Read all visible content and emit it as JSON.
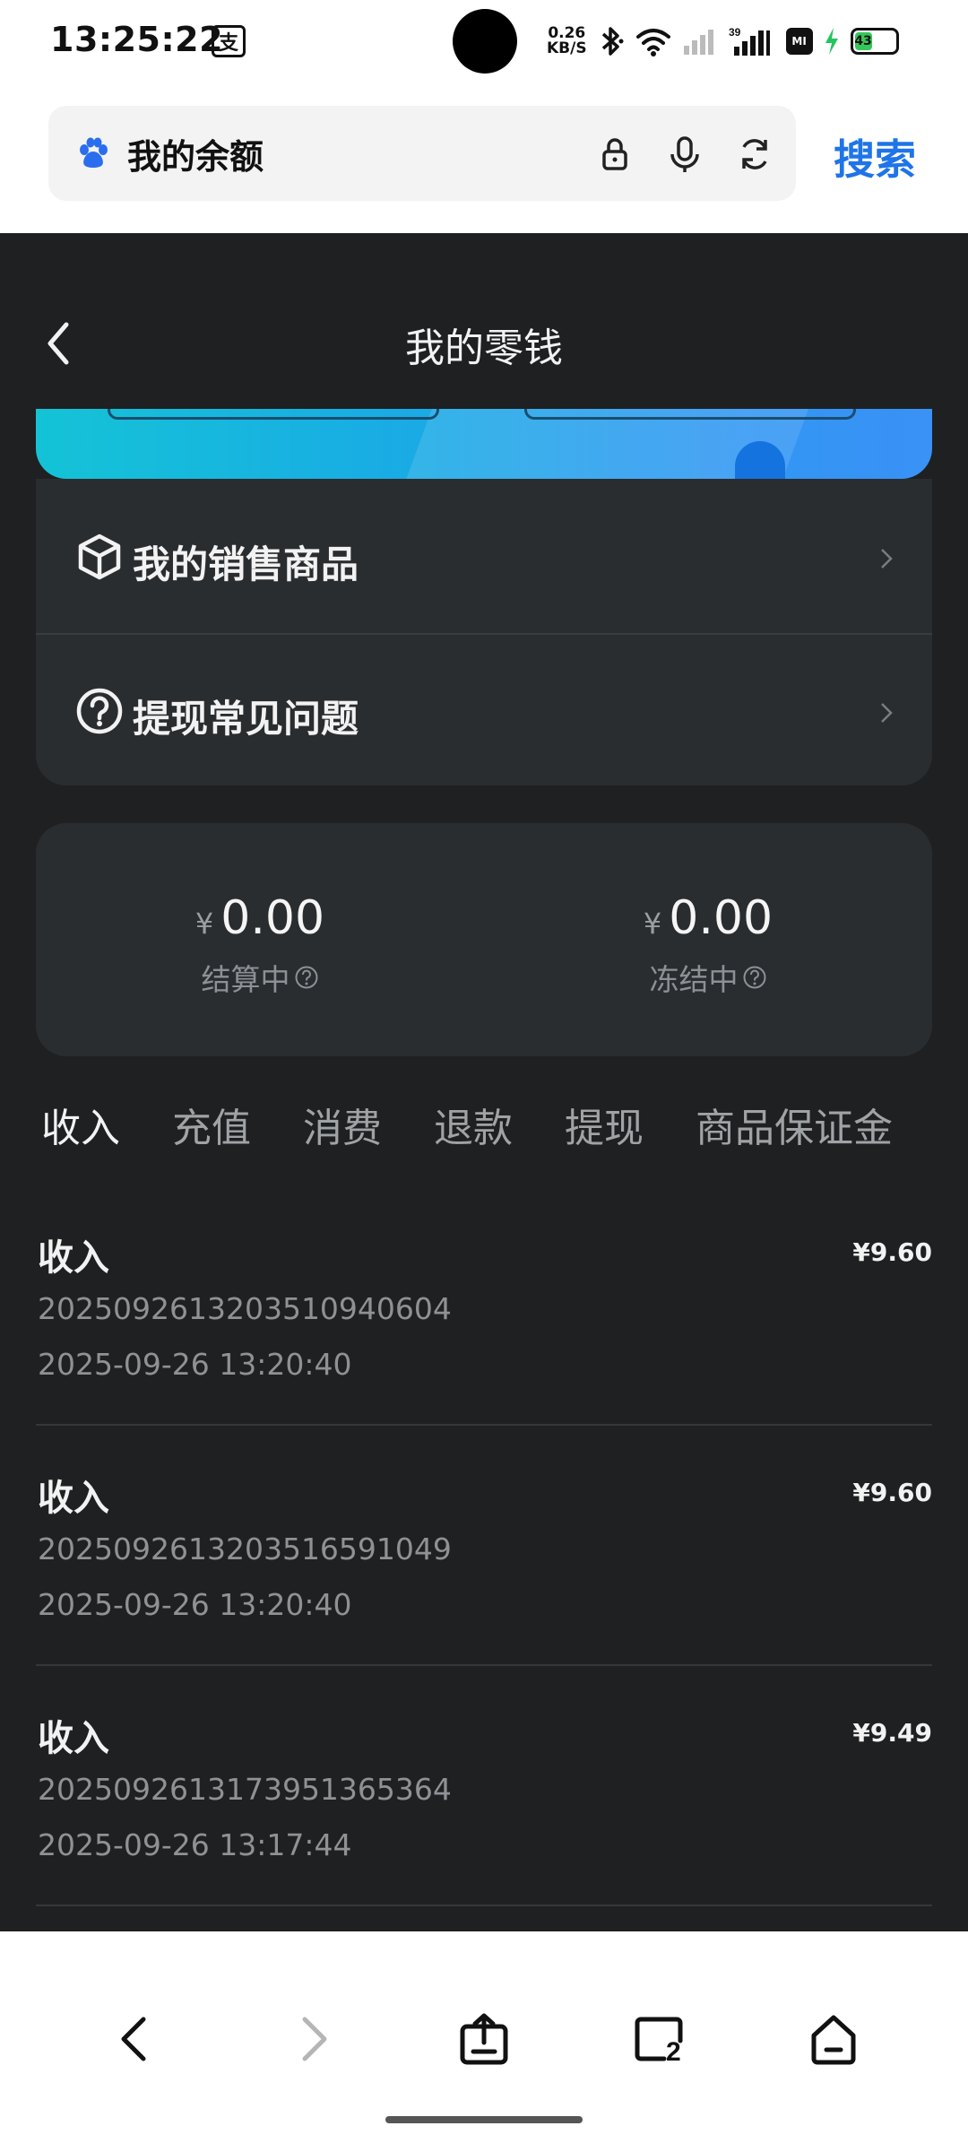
{
  "status_bar": {
    "time": "13:25:22",
    "app_badge": "支",
    "net_speed_value": "0.26",
    "net_speed_unit": "KB/S",
    "signal_label": "39",
    "battery_level": "43"
  },
  "browser": {
    "url_text": "我的余额",
    "search_label": "搜索"
  },
  "page": {
    "title": "我的零钱"
  },
  "menu": {
    "items": [
      {
        "label": "我的销售商品",
        "icon": "cube-icon"
      },
      {
        "label": "提现常见问题",
        "icon": "question-circle-icon"
      }
    ]
  },
  "balance": {
    "currency": "¥",
    "settling": {
      "amount": "0.00",
      "label": "结算中"
    },
    "frozen": {
      "amount": "0.00",
      "label": "冻结中"
    }
  },
  "tabs": [
    {
      "label": "收入",
      "active": true
    },
    {
      "label": "充值",
      "active": false
    },
    {
      "label": "消费",
      "active": false
    },
    {
      "label": "退款",
      "active": false
    },
    {
      "label": "提现",
      "active": false
    },
    {
      "label": "商品保证金",
      "active": false
    }
  ],
  "transactions": [
    {
      "type": "收入",
      "amount": "¥9.60",
      "order_id": "20250926132035109406​04",
      "time": "2025-09-26 13:20:40"
    },
    {
      "type": "收入",
      "amount": "¥9.60",
      "order_id": "2025092613203516591049",
      "time": "2025-09-26 13:20:40"
    },
    {
      "type": "收入",
      "amount": "¥9.49",
      "order_id": "2025092613173951365364",
      "time": "2025-09-26 13:17:44"
    }
  ],
  "bottom_nav": {
    "tab_count": "2"
  },
  "colors": {
    "accent": "#1e74e8",
    "background": "#1e2022",
    "card": "#2a2d30"
  }
}
